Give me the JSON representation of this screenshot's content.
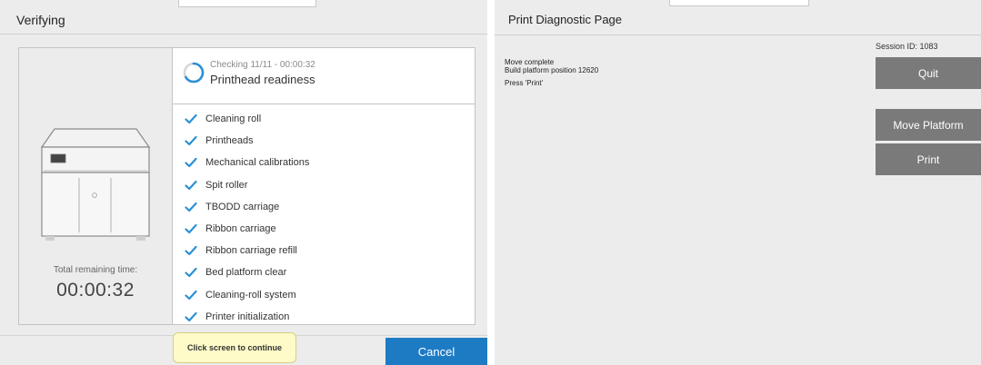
{
  "left_panel": {
    "title": "Verifying",
    "total_remaining_label": "Total remaining time:",
    "total_remaining_time": "00:00:32",
    "checking_status": "Checking 11/11 - 00:00:32",
    "current_check": "Printhead readiness",
    "check_items": [
      {
        "label": "Cleaning roll",
        "status": "done"
      },
      {
        "label": "Printheads",
        "status": "done"
      },
      {
        "label": "Mechanical calibrations",
        "status": "done"
      },
      {
        "label": "Spit roller",
        "status": "done"
      },
      {
        "label": "TBODD carriage",
        "status": "done"
      },
      {
        "label": "Ribbon carriage",
        "status": "done"
      },
      {
        "label": "Ribbon carriage refill",
        "status": "done"
      },
      {
        "label": "Bed platform clear",
        "status": "done"
      },
      {
        "label": "Cleaning-roll system",
        "status": "done"
      },
      {
        "label": "Printer initialization",
        "status": "done"
      }
    ],
    "continue_tooltip": "Click screen to continue",
    "cancel_label": "Cancel"
  },
  "right_panel": {
    "title": "Print Diagnostic Page",
    "session_id": "Session ID: 1083",
    "messages": [
      "Move complete",
      "Build platform position 12620",
      "Press 'Print'"
    ],
    "quit_label": "Quit",
    "move_platform_label": "Move Platform",
    "print_label": "Print"
  },
  "colors": {
    "accent_blue": "#1d7bc4",
    "check_blue": "#2a90d6",
    "gray_button": "#7a7a7a",
    "tooltip_yellow": "#fefbc8",
    "panel_bg": "#ececec"
  },
  "icons": {
    "spinner": "loading-spinner-icon",
    "check": "checkmark-icon",
    "printer": "printer-illustration"
  }
}
